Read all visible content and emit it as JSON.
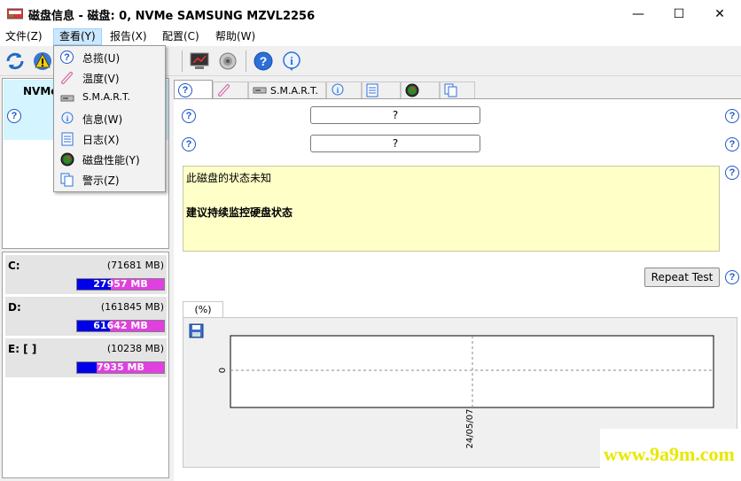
{
  "window": {
    "title": "磁盘信息 - 磁盘:  0, NVMe    SAMSUNG MZVL2256",
    "minimize": "—",
    "maximize": "☐",
    "close": "✕"
  },
  "menu": {
    "file": "文件(Z)",
    "view": "查看(Y)",
    "report": "报告(X)",
    "config": "配置(C)",
    "help": "帮助(W)"
  },
  "view_menu": {
    "items": [
      {
        "label": "总揽(U)",
        "icon": "question-icon"
      },
      {
        "label": "温度(V)",
        "icon": "thermometer-icon"
      },
      {
        "label": "S.M.A.R.T.",
        "icon": "drive-icon"
      },
      {
        "label": "信息(W)",
        "icon": "info-icon"
      },
      {
        "label": "日志(X)",
        "icon": "log-icon"
      },
      {
        "label": "磁盘性能(Y)",
        "icon": "gauge-icon"
      },
      {
        "label": "警示(Z)",
        "icon": "pages-icon"
      }
    ]
  },
  "disk_list": {
    "selected_label": "NVMe"
  },
  "volumes": [
    {
      "letter": "C:",
      "total": "(71681 MB)",
      "free": "27957 MB",
      "free_fraction": 0.39
    },
    {
      "letter": "D:",
      "total": "(161845 MB)",
      "free": "61642 MB",
      "free_fraction": 0.38
    },
    {
      "letter": "E: [    ]",
      "total": "(10238 MB)",
      "free": "7935 MB",
      "free_fraction": 0.22
    }
  ],
  "tabs": {
    "smart": "S.M.A.R.T."
  },
  "overview": {
    "field1": "?",
    "field2": "?",
    "status_line1": "此磁盘的状态未知",
    "status_line2": "建议持续监控硬盘状态",
    "repeat_button": "Repeat Test"
  },
  "chart": {
    "tab_label": "(%)",
    "y_tick": "0",
    "x_tick": "24/05/07"
  },
  "watermark": "www.9a9m.com",
  "colors": {
    "accent_blue": "#1e56c8",
    "bar_free": "#0000e8",
    "bar_used": "#e040e0",
    "status_bg": "#ffffc8",
    "disk_tile_bg": "#d4f4ff"
  }
}
